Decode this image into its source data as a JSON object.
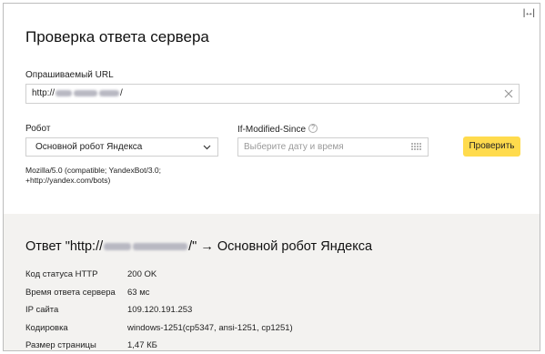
{
  "header": {
    "title": "Проверка ответа сервера",
    "expand_icon": "↔",
    "expand_label": "|↔|"
  },
  "form": {
    "url_label": "Опрашиваемый URL",
    "url_value_prefix": "http://",
    "url_value_suffix": "/",
    "robot_label": "Робот",
    "robot_selected": "Основной робот Яндекса",
    "ims_label": "If-Modified-Since",
    "ims_help": "?",
    "ims_placeholder": "Выберите дату и время",
    "check_button": "Проверить",
    "user_agent_line1": "Mozilla/5.0 (compatible; YandexBot/3.0;",
    "user_agent_line2": "+http://yandex.com/bots)"
  },
  "result": {
    "title_prefix": "Ответ \"http://",
    "title_suffix": "/\" → Основной робот Яндекса",
    "rows": [
      {
        "key": "Код статуса HTTP",
        "value": "200 OK"
      },
      {
        "key": "Время ответа сервера",
        "value": "63 мс"
      },
      {
        "key": "IP сайта",
        "value": "109.120.191.253"
      },
      {
        "key": "Кодировка",
        "value": "windows-1251(cp5347, ansi-1251, cp1251)"
      },
      {
        "key": "Размер страницы",
        "value": "1,47 КБ"
      }
    ]
  },
  "colors": {
    "accent_button": "#ffdb4d",
    "results_bg": "#f3f2f0",
    "border": "#cfcfcf"
  }
}
